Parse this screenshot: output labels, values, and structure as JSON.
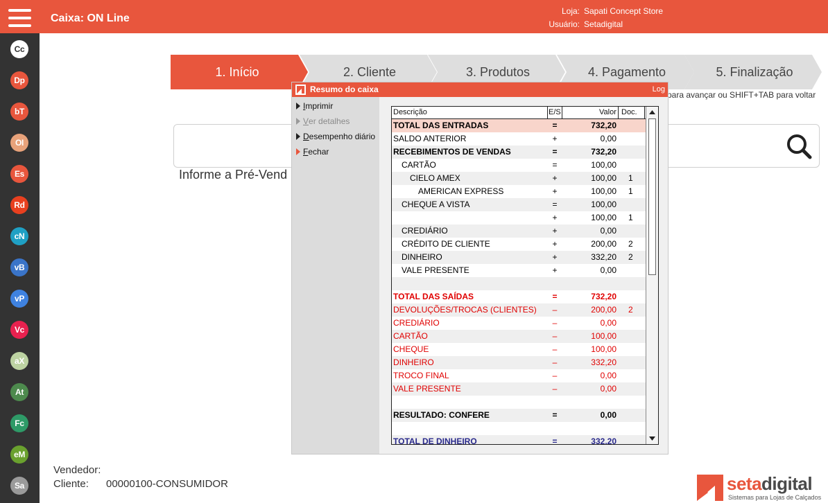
{
  "app": {
    "title": "Caixa: ON Line",
    "store_label": "Loja:",
    "store_value": "Sapati Concept Store",
    "user_label": "Usuário:",
    "user_value": "Setadigital"
  },
  "sidebar": {
    "items": [
      {
        "code": "Cc",
        "color": "#ffffff",
        "text_color": "#333333"
      },
      {
        "code": "Dp",
        "color": "#e8563d"
      },
      {
        "code": "bT",
        "color": "#e8563d"
      },
      {
        "code": "OI",
        "color": "#e8a27a"
      },
      {
        "code": "Es",
        "color": "#e8563d"
      },
      {
        "code": "Rd",
        "color": "#e8401f"
      },
      {
        "code": "cN",
        "color": "#1fa0c4"
      },
      {
        "code": "vB",
        "color": "#3a74c8"
      },
      {
        "code": "vP",
        "color": "#3f82e0"
      },
      {
        "code": "Vc",
        "color": "#e8214f"
      },
      {
        "code": "aX",
        "color": "#bdd3a2"
      },
      {
        "code": "At",
        "color": "#4d8a4d"
      },
      {
        "code": "Fc",
        "color": "#2e9a67"
      },
      {
        "code": "eM",
        "color": "#6aa12e"
      },
      {
        "code": "Sa",
        "color": "#9a9a9a"
      }
    ]
  },
  "steps": [
    {
      "label": "1. Início",
      "active": true
    },
    {
      "label": "2. Cliente",
      "active": false
    },
    {
      "label": "3. Produtos",
      "active": false
    },
    {
      "label": "4. Pagamento",
      "active": false
    },
    {
      "label": "5. Finalização",
      "active": false
    }
  ],
  "hint": "para avançar ou SHIFT+TAB para voltar",
  "search": {
    "label": "Informe a Pré-Vend"
  },
  "footer": {
    "vendedor_label": "Vendedor:",
    "cliente_label": "Cliente:",
    "cliente_value": "00000100-CONSUMIDOR"
  },
  "logo": {
    "seta": "seta",
    "digital": "digital",
    "sub": "Sistemas para Lojas de Calçados"
  },
  "dialog": {
    "title": "Resumo do caixa",
    "log": "Log",
    "menu": {
      "imprimir": {
        "first": "I",
        "rest": "mprimir"
      },
      "ver_detalhes": {
        "first": "V",
        "rest": "er detalhes"
      },
      "desempenho": {
        "first": "D",
        "rest": "esempenho diário"
      },
      "fechar": {
        "first": "F",
        "rest": "echar"
      }
    },
    "columns": {
      "desc": "Descrição",
      "es": "E/S",
      "valor": "Valor",
      "doc": "Doc."
    },
    "rows": [
      {
        "desc": "TOTAL DAS ENTRADAS",
        "es": "=",
        "valor": "732,20",
        "doc": "",
        "indent": 0,
        "style": "bold hl"
      },
      {
        "desc": "SALDO ANTERIOR",
        "es": "+",
        "valor": "0,00",
        "doc": "",
        "indent": 0,
        "style": ""
      },
      {
        "desc": "RECEBIMENTOS DE VENDAS",
        "es": "=",
        "valor": "732,20",
        "doc": "",
        "indent": 0,
        "style": "bold alt"
      },
      {
        "desc": "CARTÃO",
        "es": "=",
        "valor": "100,00",
        "doc": "",
        "indent": 1,
        "style": ""
      },
      {
        "desc": "CIELO AMEX",
        "es": "+",
        "valor": "100,00",
        "doc": "1",
        "indent": 2,
        "style": "alt"
      },
      {
        "desc": "AMERICAN EXPRESS",
        "es": "+",
        "valor": "100,00",
        "doc": "1",
        "indent": 3,
        "style": ""
      },
      {
        "desc": "CHEQUE A VISTA",
        "es": "=",
        "valor": "100,00",
        "doc": "",
        "indent": 1,
        "style": "alt"
      },
      {
        "desc": "",
        "es": "+",
        "valor": "100,00",
        "doc": "1",
        "indent": 1,
        "style": ""
      },
      {
        "desc": "CREDIÁRIO",
        "es": "+",
        "valor": "0,00",
        "doc": "",
        "indent": 1,
        "style": "alt"
      },
      {
        "desc": "CRÉDITO DE CLIENTE",
        "es": "+",
        "valor": "200,00",
        "doc": "2",
        "indent": 1,
        "style": ""
      },
      {
        "desc": "DINHEIRO",
        "es": "+",
        "valor": "332,20",
        "doc": "2",
        "indent": 1,
        "style": "alt"
      },
      {
        "desc": "VALE PRESENTE",
        "es": "+",
        "valor": "0,00",
        "doc": "",
        "indent": 1,
        "style": ""
      },
      {
        "desc": "",
        "es": "",
        "valor": "",
        "doc": "",
        "indent": 0,
        "style": "alt"
      },
      {
        "desc": "TOTAL DAS SAÍDAS",
        "es": "=",
        "valor": "732,20",
        "doc": "",
        "indent": 0,
        "style": "bold red"
      },
      {
        "desc": "DEVOLUÇÕES/TROCAS (CLIENTES)",
        "es": "–",
        "valor": "200,00",
        "doc": "2",
        "indent": 0,
        "style": "red alt"
      },
      {
        "desc": "CREDIÁRIO",
        "es": "–",
        "valor": "0,00",
        "doc": "",
        "indent": 0,
        "style": "red"
      },
      {
        "desc": "CARTÃO",
        "es": "–",
        "valor": "100,00",
        "doc": "",
        "indent": 0,
        "style": "red alt"
      },
      {
        "desc": "CHEQUE",
        "es": "–",
        "valor": "100,00",
        "doc": "",
        "indent": 0,
        "style": "red"
      },
      {
        "desc": "DINHEIRO",
        "es": "–",
        "valor": "332,20",
        "doc": "",
        "indent": 0,
        "style": "red alt"
      },
      {
        "desc": "TROCO FINAL",
        "es": "–",
        "valor": "0,00",
        "doc": "",
        "indent": 0,
        "style": "red"
      },
      {
        "desc": "VALE PRESENTE",
        "es": "–",
        "valor": "0,00",
        "doc": "",
        "indent": 0,
        "style": "red alt"
      },
      {
        "desc": "",
        "es": "",
        "valor": "",
        "doc": "",
        "indent": 0,
        "style": ""
      },
      {
        "desc": "RESULTADO: CONFERE",
        "es": "=",
        "valor": "0,00",
        "doc": "",
        "indent": 0,
        "style": "bold alt"
      },
      {
        "desc": "",
        "es": "",
        "valor": "",
        "doc": "",
        "indent": 0,
        "style": ""
      },
      {
        "desc": "TOTAL DE DINHEIRO",
        "es": "=",
        "valor": "332,20",
        "doc": "",
        "indent": 0,
        "style": "bold blue alt"
      }
    ]
  },
  "colors": {
    "accent": "#e8563d",
    "sidebar": "#333333",
    "step_inactive": "#dedede"
  }
}
